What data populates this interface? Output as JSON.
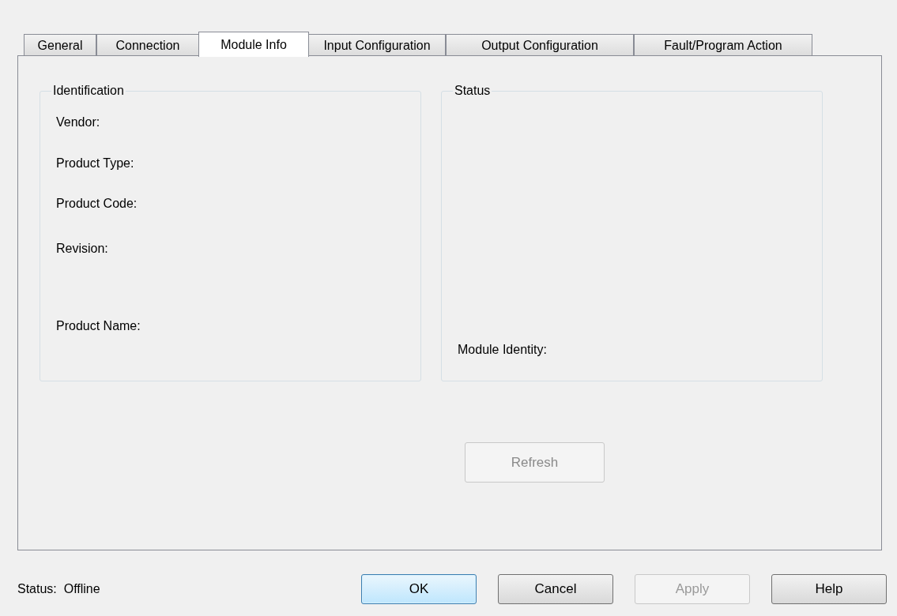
{
  "tabs": [
    {
      "label": "General",
      "selected": false
    },
    {
      "label": "Connection",
      "selected": false
    },
    {
      "label": "Module Info",
      "selected": true
    },
    {
      "label": "Input Configuration",
      "selected": false
    },
    {
      "label": "Output Configuration",
      "selected": false
    },
    {
      "label": "Fault/Program Action",
      "selected": false
    }
  ],
  "identification": {
    "title": "Identification",
    "fields": [
      "Vendor:",
      "Product Type:",
      "Product Code:",
      "Revision:",
      "Product Name:"
    ]
  },
  "status_group": {
    "title": "Status",
    "fields": [
      "Module Identity:"
    ]
  },
  "refresh_button": {
    "label": "Refresh",
    "disabled": true
  },
  "status_bar": "Status:  Offline",
  "buttons": [
    {
      "label": "OK",
      "disabled": false,
      "default": true
    },
    {
      "label": "Cancel",
      "disabled": false,
      "default": false
    },
    {
      "label": "Apply",
      "disabled": true,
      "default": false
    },
    {
      "label": "Help",
      "disabled": false,
      "default": false
    }
  ]
}
